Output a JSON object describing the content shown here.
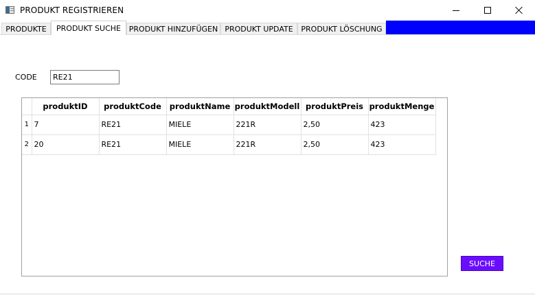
{
  "window": {
    "title": "PRODUKT REGISTRIEREN"
  },
  "tabs": [
    {
      "label": "PRODUKTE",
      "active": false
    },
    {
      "label": "PRODUKT SUCHE",
      "active": true
    },
    {
      "label": "PRODUKT HINZUFÜGEN",
      "active": false
    },
    {
      "label": "PRODUKT UPDATE",
      "active": false
    },
    {
      "label": "PRODUKT LÖSCHUNG",
      "active": false
    }
  ],
  "colors": {
    "tab_filler": "#0000ff",
    "search_button": "#6a0dff"
  },
  "search": {
    "code_label": "CODE",
    "code_value": "RE21",
    "button_label": "SUCHE"
  },
  "table": {
    "columns": [
      "produktID",
      "produktCode",
      "produktName",
      "produktModell",
      "produktPreis",
      "produktMenge"
    ],
    "rows": [
      {
        "row_number": "1",
        "cells": [
          "7",
          "RE21",
          "MIELE",
          "221R",
          "2,50",
          "423"
        ]
      },
      {
        "row_number": "2",
        "cells": [
          "20",
          "RE21",
          "MIELE",
          "221R",
          "2,50",
          "423"
        ]
      }
    ]
  }
}
